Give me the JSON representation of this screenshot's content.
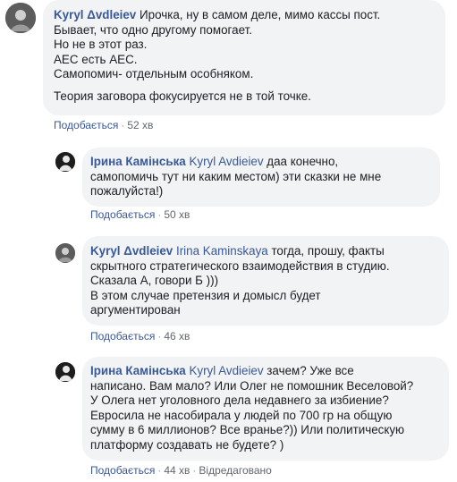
{
  "comments": [
    {
      "author": "Kyryl Δvdleiev",
      "avatar_icon": "user-avatar-icon",
      "mention": "",
      "lines": [
        "Ирочка, ну в самом деле, мимо кассы пост.",
        "Бывает, что одно другому помогает.",
        "Но не в этот раз.",
        "АЕС есть АЕС.",
        "Самопомич- отдельным особняком.",
        "",
        "Теория заговора фокусируется не в той точке."
      ],
      "like_label": "Подобається",
      "time": "52 хв",
      "edited": ""
    },
    {
      "author": "Ірина Камінська",
      "avatar_icon": "user-avatar-icon",
      "mention": "Kyryl Avdieiev",
      "lines": [
        "даа конечно,",
        "самопомичь тут ни каким местом) эти сказки не мне",
        "пожалуйста!)"
      ],
      "like_label": "Подобається",
      "time": "50 хв",
      "edited": ""
    },
    {
      "author": "Kyryl Δvdleiev",
      "avatar_icon": "user-avatar-icon",
      "mention": "Irina Kaminskaya",
      "lines": [
        "тогда, прошу, факты",
        "скрытного стратегического взаимодействия в студию.",
        "Сказала А, говори Б )))",
        "В этом случае претензия и домысл будет",
        "аргументирован"
      ],
      "like_label": "Подобається",
      "time": "46 хв",
      "edited": ""
    },
    {
      "author": "Ірина Камінська",
      "avatar_icon": "user-avatar-icon",
      "mention": "Kyryl Avdieiev",
      "lines": [
        "зачем? Уже все",
        "написано. Вам мало? Или Олег не помошник Веселовой?",
        "У Олега нет уголовного дела недавнего за избиение?",
        "Евросила не насобирала у людей по 700 гр на общую",
        "сумму в 6 миллионов? Все вранье?)) Или политическую",
        "платформу создавать не будете? )"
      ],
      "like_label": "Подобається",
      "time": "44 хв",
      "edited": "Відредаговано"
    }
  ]
}
